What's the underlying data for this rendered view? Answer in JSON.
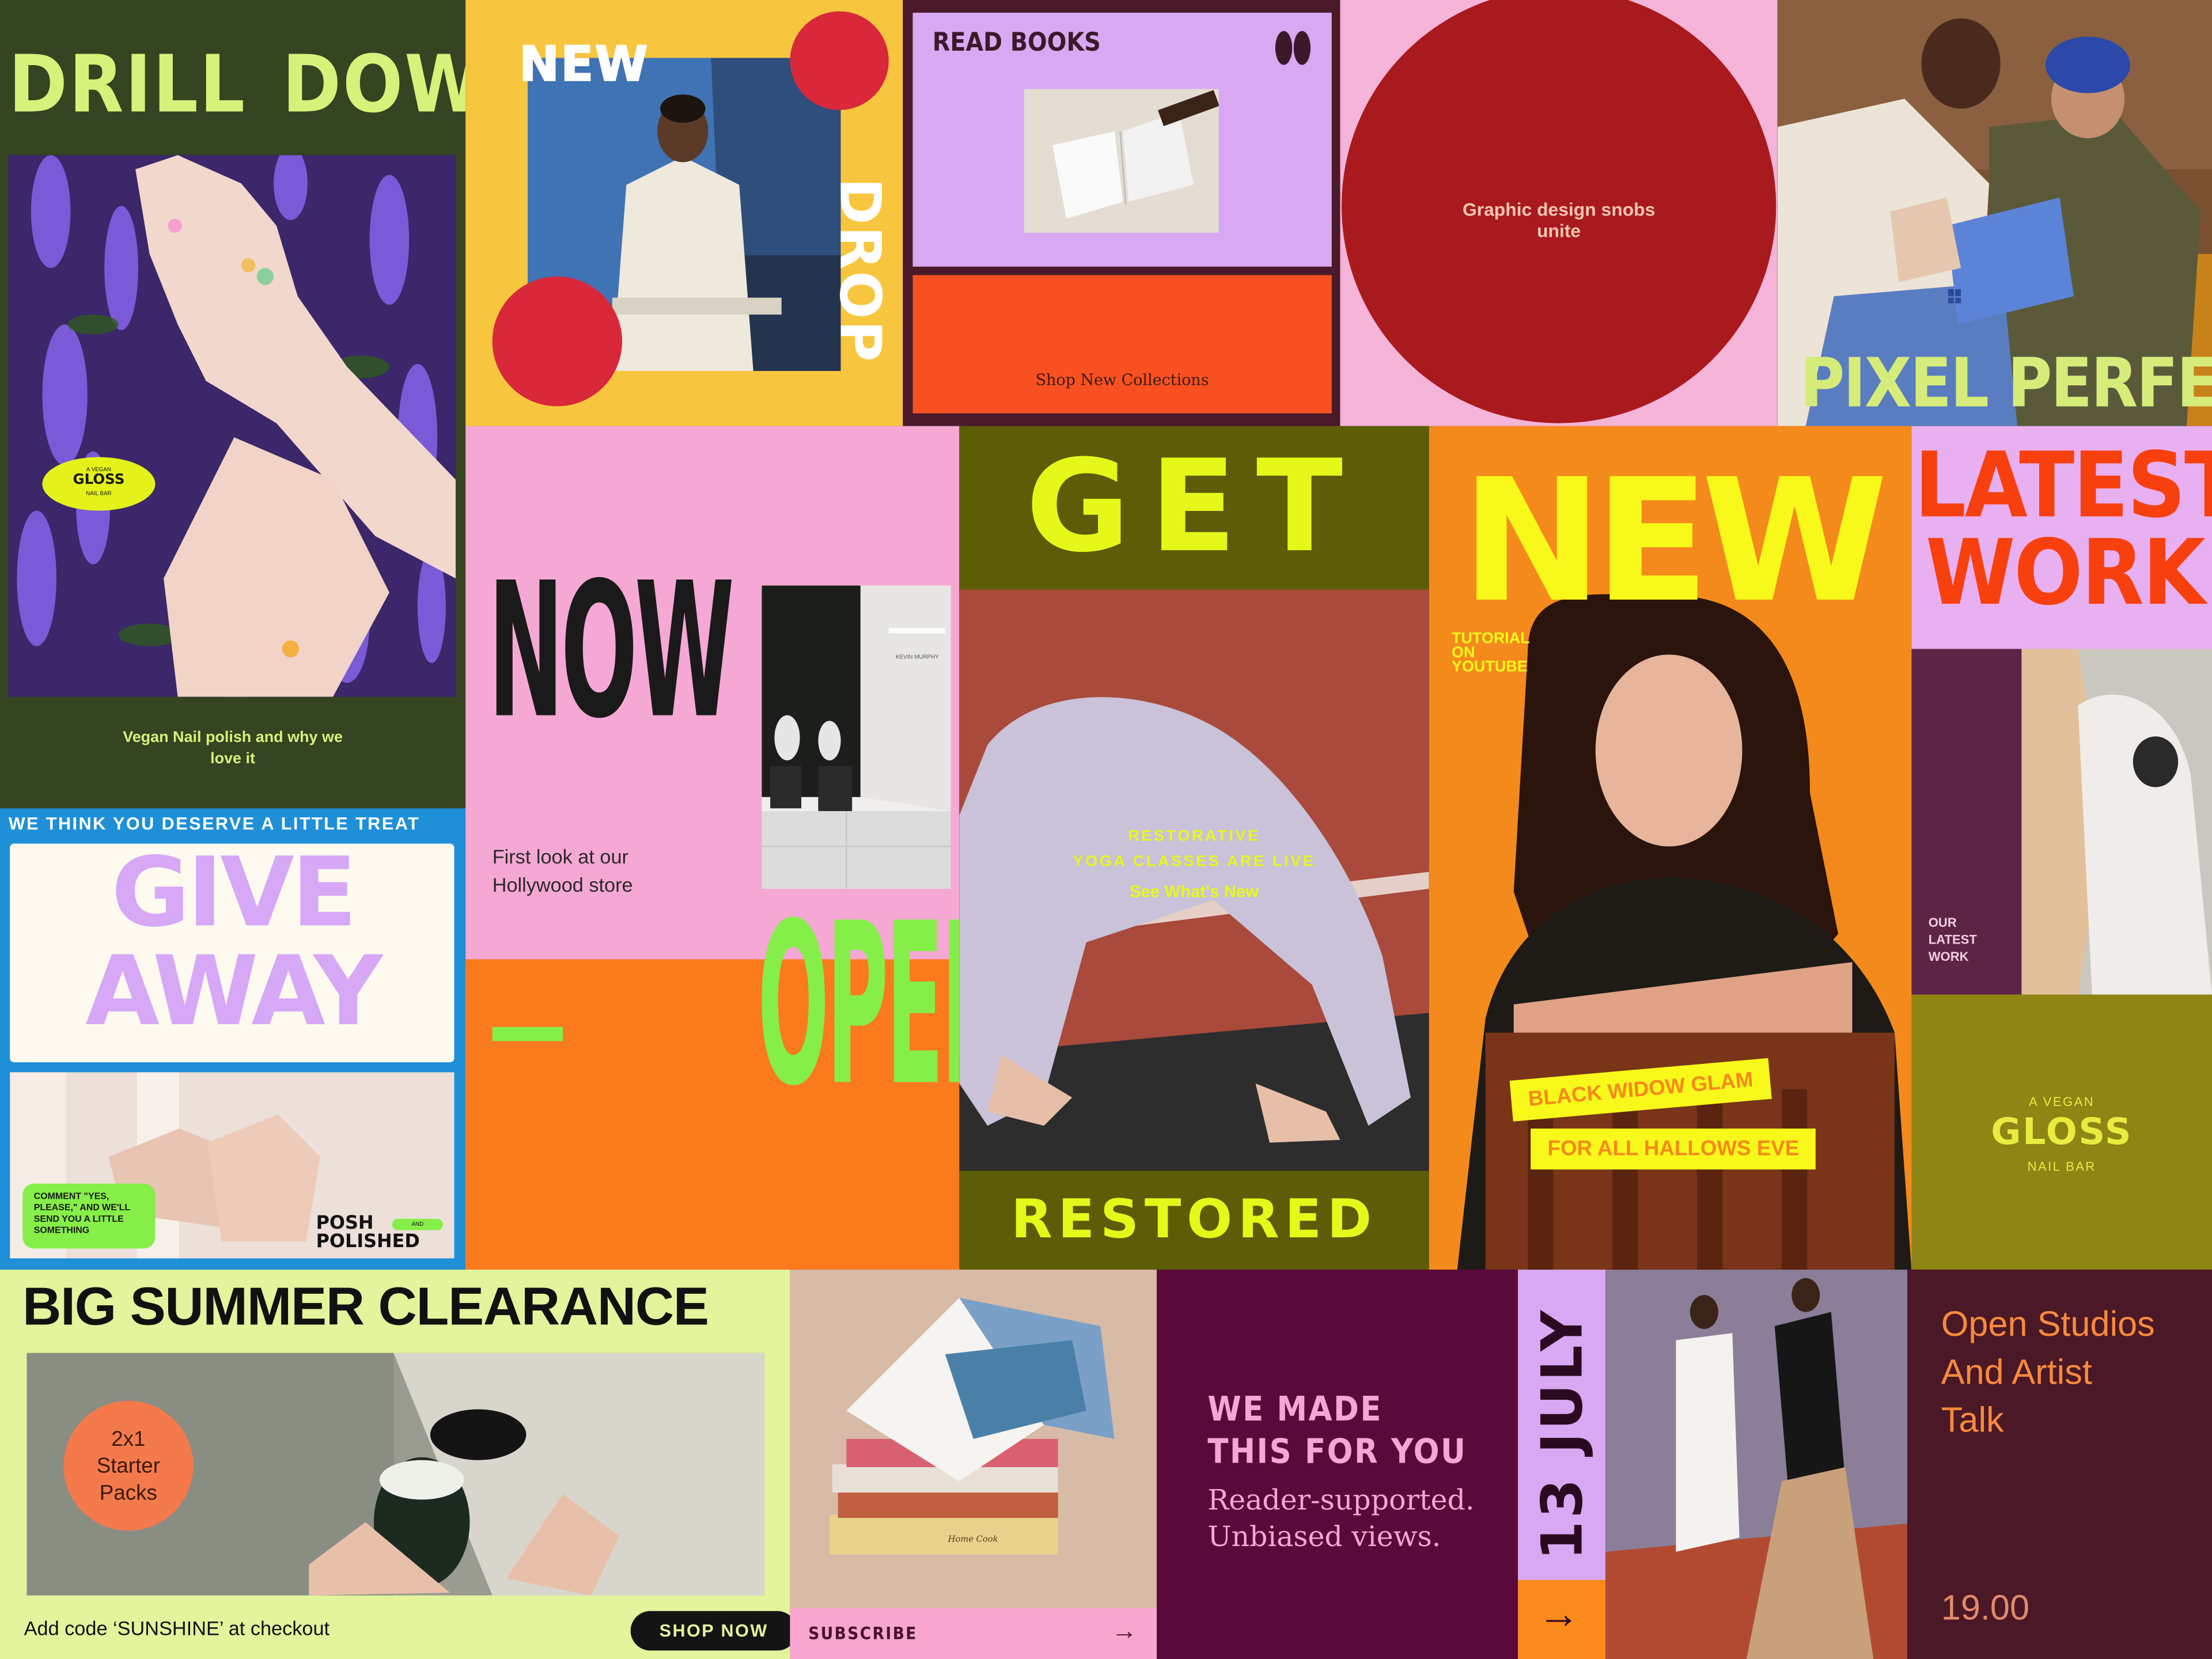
{
  "tiles": {
    "drill": {
      "title_left": "DRILL",
      "title_right": "DOWN",
      "badge_small_top": "A VEGAN",
      "badge_word": "GLOSS",
      "badge_small_bottom": "NAIL BAR",
      "caption": "Vegan Nail polish and why we love it"
    },
    "new_drop": {
      "word1": "NEW",
      "word2": "DROP"
    },
    "read_books": {
      "title": "READ BOOKS",
      "cta": "Shop New Collections"
    },
    "design_snobs": {
      "text": "Graphic design snobs unite"
    },
    "pixel": {
      "title": "PIXEL PERFECT"
    },
    "now_open": {
      "word_now": "NOW",
      "caption": "First look at our Hollywood store",
      "word_open": "OPEN",
      "sign_text": "KEVIN MURPHY"
    },
    "get_restored": {
      "word_top": "GET",
      "line1": "RESTORATIVE",
      "line2": "YOGA CLASSES ARE LIVE",
      "link": "See What's New",
      "word_bottom": "RESTORED"
    },
    "new_tutorial": {
      "word": "NEW",
      "sub1": "TUTORIAL",
      "sub2": "ON",
      "sub3": "YOUTUBE",
      "tag1": "BLACK WIDOW GLAM",
      "tag2": "FOR ALL HALLOWS EVE"
    },
    "latest": {
      "line1": "LATEST",
      "line2": "WORK",
      "side1": "OUR",
      "side2": "LATEST",
      "side3": "WORK",
      "brand_small_top": "A VEGAN",
      "brand": "GLOSS",
      "brand_small_bottom": "NAIL BAR"
    },
    "giveaway": {
      "banner": "WE THINK YOU DESERVE A LITTLE TREAT",
      "line1": "GIVE",
      "line2": "AWAY",
      "comment": "COMMENT \"YES, PLEASE,\" AND WE'LL SEND YOU A LITTLE SOMETHING",
      "brand_line1": "POSH",
      "brand_and": "AND",
      "brand_line2": "POLISHED"
    },
    "summer": {
      "title": "BIG SUMMER CLEARANCE",
      "badge1": "2x1",
      "badge2": "Starter",
      "badge3": "Packs",
      "code": "Add code ‘SUNSHINE’ at checkout",
      "cta": "SHOP NOW"
    },
    "subscribe": {
      "cta": "SUBSCRIBE",
      "arrow": "→",
      "book_title": "Home Cook"
    },
    "made_for_you": {
      "line1": "WE MADE",
      "line2": "THIS FOR YOU",
      "sub1": "Reader-supported.",
      "sub2": "Unbiased views."
    },
    "july": {
      "date": "13 JULY",
      "arrow": "→"
    },
    "open_studios": {
      "line1": "Open Studios",
      "line2": "And Artist",
      "line3": "Talk",
      "time": "19.00"
    }
  },
  "icons": {
    "dots": "double-dot-icon",
    "arrow": "arrow-right-icon",
    "logo": "windows-logo-icon"
  },
  "colors": {
    "olive_dark": "#34431f",
    "lime": "#d6f27a",
    "yellow": "#f8c33c",
    "red": "#d8283a",
    "lilac": "#d8a8f2",
    "orange": "#f85020",
    "pink": "#f6b2d9",
    "crimson": "#a91a1f",
    "green_neon": "#86ee48",
    "plum": "#5a0a3a",
    "maroon": "#4a1826"
  }
}
